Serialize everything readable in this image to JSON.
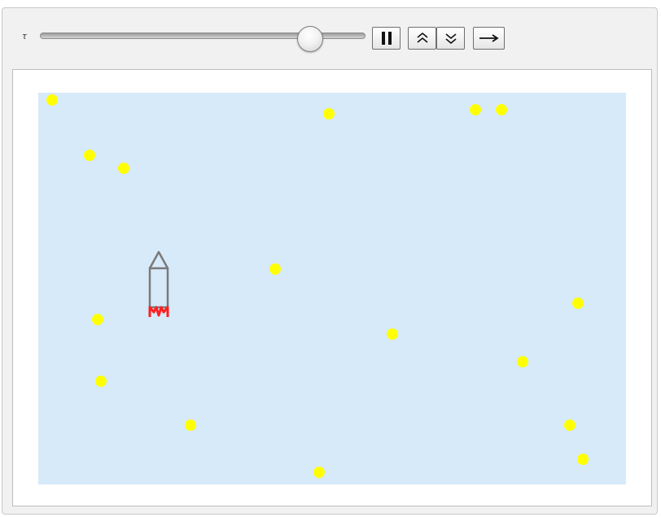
{
  "controls": {
    "slider_label": "τ",
    "slider_value_fraction": 0.83,
    "buttons": [
      {
        "name": "pause-button",
        "icon": "pause-icon"
      },
      {
        "name": "faster-button",
        "icon": "double-chevron-up-icon"
      },
      {
        "name": "slower-button",
        "icon": "double-chevron-down-icon"
      },
      {
        "name": "direction-button",
        "icon": "arrow-right-icon"
      }
    ]
  },
  "scene": {
    "background_color": "#d7eafa",
    "star_color": "#ffff00",
    "rocket_color": "#7a7a7a",
    "flame_color": "#ff2020",
    "xlim": [
      0,
      722
    ],
    "ylim": [
      0,
      482
    ],
    "stars": [
      {
        "x": 17,
        "y": 473
      },
      {
        "x": 357,
        "y": 456
      },
      {
        "x": 537,
        "y": 461
      },
      {
        "x": 569,
        "y": 461
      },
      {
        "x": 63,
        "y": 405
      },
      {
        "x": 105,
        "y": 389
      },
      {
        "x": 291,
        "y": 265
      },
      {
        "x": 663,
        "y": 223
      },
      {
        "x": 73,
        "y": 203
      },
      {
        "x": 435,
        "y": 185
      },
      {
        "x": 595,
        "y": 151
      },
      {
        "x": 77,
        "y": 127
      },
      {
        "x": 187,
        "y": 73
      },
      {
        "x": 653,
        "y": 73
      },
      {
        "x": 669,
        "y": 31
      },
      {
        "x": 345,
        "y": 15
      }
    ],
    "rocket": {
      "x": 148,
      "y": 216
    }
  }
}
